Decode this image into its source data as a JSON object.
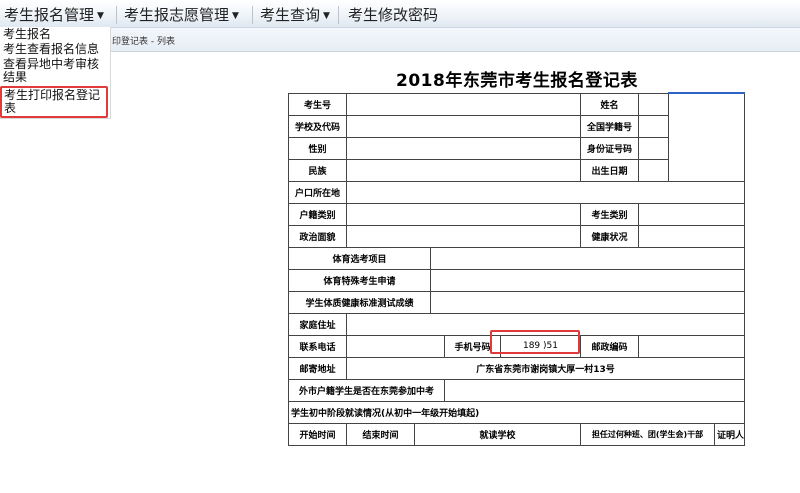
{
  "menu": {
    "items": [
      {
        "label": "考生报名管理",
        "has_caret": true
      },
      {
        "label": "考生报志愿管理",
        "has_caret": true
      },
      {
        "label": "考生查询",
        "has_caret": true
      },
      {
        "label": "考生修改密码",
        "has_caret": false
      }
    ],
    "caret": "▼",
    "dropdown": [
      "考生报名",
      "考生查看报名信息",
      "查看异地中考审核结果",
      "考生打印报名登记表"
    ]
  },
  "breadcrumb": "印登记表 - 列表",
  "form": {
    "title": "2018年东莞市考生报名登记表",
    "labels": {
      "exam_no": "考生号",
      "name": "姓名",
      "school": "学校及代码",
      "national_id": "全国学籍号",
      "gender": "性别",
      "id_card": "身份证号码",
      "ethnicity": "民族",
      "birth": "出生日期",
      "hukou_location": "户口所在地",
      "hukou_type": "户籍类别",
      "student_type": "考生类别",
      "political": "政治面貌",
      "health": "健康状况",
      "pe_items": "体育选考项目",
      "pe_special": "体育特殊考生申请",
      "fitness": "学生体质健康标准测试成绩",
      "address": "家庭住址",
      "phone": "联系电话",
      "mobile": "手机号码",
      "postcode": "邮政编码",
      "mail_address": "邮寄地址",
      "outside_hukou": "外市户籍学生是否在东莞参加中考",
      "history": "学生初中阶段就读情况(从初中一年级开始填起)",
      "start": "开始时间",
      "end": "结束时间",
      "school_attended": "就读学校",
      "position": "担任过何种班、团(学生会)干部",
      "witness": "证明人"
    },
    "values": {
      "mobile": "189        )51",
      "mail_address": "广东省东莞市谢岗镇大厚一村13号"
    }
  }
}
